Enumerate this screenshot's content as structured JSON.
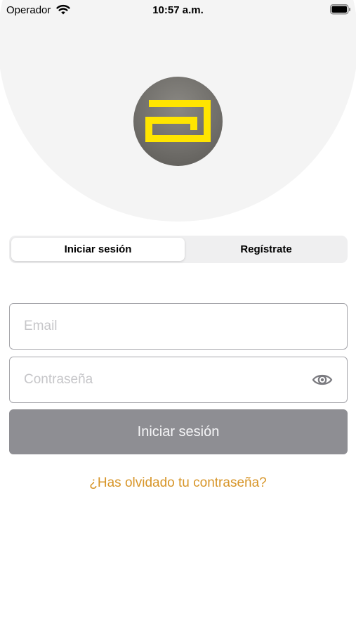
{
  "status_bar": {
    "carrier": "Operador",
    "time": "10:57 a.m.",
    "wifi_icon": "wifi-icon",
    "battery_icon": "battery-icon"
  },
  "logo": {
    "icon": "brand-logo-icon",
    "background_color": "#6e6c68",
    "mark_color": "#ffe500"
  },
  "tabs": {
    "login_label": "Iniciar sesión",
    "register_label": "Regístrate",
    "selected": "login"
  },
  "form": {
    "email_placeholder": "Email",
    "email_value": "",
    "password_placeholder": "Contraseña",
    "password_value": "",
    "password_toggle_icon": "eye-icon",
    "submit_label": "Iniciar sesión",
    "forgot_label": "¿Has olvidado tu contraseña?"
  },
  "colors": {
    "header_background": "#f4f4f4",
    "submit_background": "#8e8e93",
    "link": "#d79528"
  }
}
